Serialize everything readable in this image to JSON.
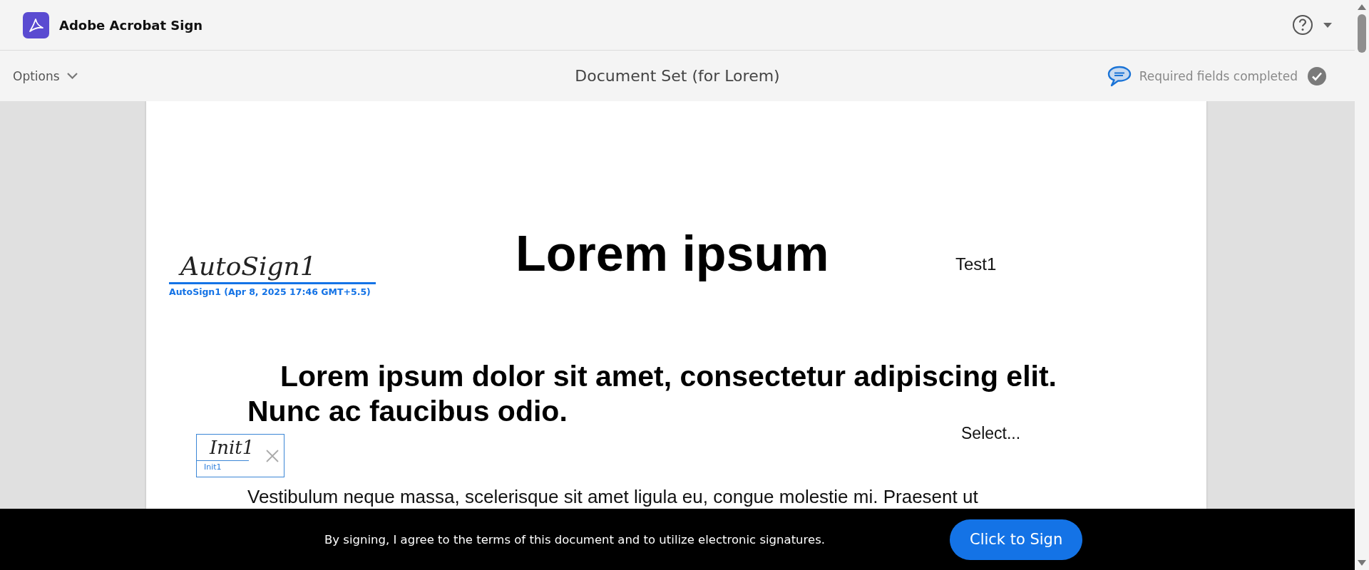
{
  "app": {
    "name": "Adobe Acrobat Sign"
  },
  "toolbar": {
    "options": "Options",
    "document_title": "Document Set (for Lorem)",
    "status": "Required fields completed",
    "completed": true
  },
  "document": {
    "title": "Lorem ipsum",
    "signature": {
      "value": "AutoSign1",
      "caption": "AutoSign1 (Apr 8, 2025 17:46 GMT+5.5)"
    },
    "text_field": "Test1",
    "heading": "Lorem ipsum dolor sit amet, consectetur adipiscing elit. Nunc ac faucibus odio.",
    "dropdown": "Select...",
    "initials": {
      "value": "Init1",
      "caption": "Init1"
    },
    "body": "Vestibulum neque massa, scelerisque sit amet ligula eu, congue molestie mi. Praesent ut"
  },
  "footer": {
    "notice": "By signing, I agree to the terms of this document and to utilize electronic signatures.",
    "button": "Click to Sign"
  }
}
